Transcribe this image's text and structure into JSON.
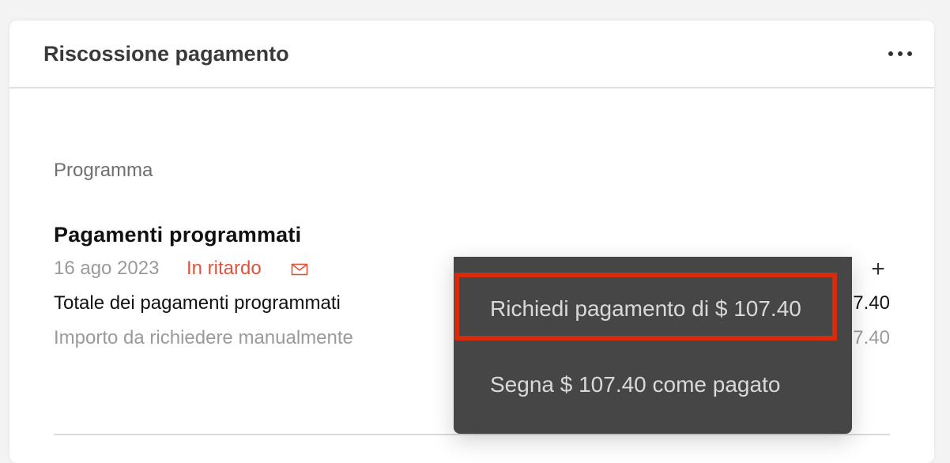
{
  "card": {
    "title": "Riscossione pagamento",
    "more_icon": "ellipsis-horizontal-icon"
  },
  "section": {
    "label": "Programma"
  },
  "scheduled": {
    "title": "Pagamenti programmati",
    "date": "16 ago 2023",
    "status": "In ritardo",
    "status_color": "#e0533a",
    "mail_icon": "mail-icon",
    "add_icon": "plus-icon",
    "total_label": "Totale dei pagamenti programmati",
    "total_value": "7.40",
    "manual_label": "Importo da richiedere manualmente",
    "manual_value": "7.40"
  },
  "menu": {
    "items": [
      {
        "label": "Richiedi pagamento di $ 107.40",
        "highlighted": true
      },
      {
        "label": "Segna $ 107.40 come pagato"
      }
    ],
    "highlight_color": "#d62c0d",
    "background": "#464646"
  }
}
